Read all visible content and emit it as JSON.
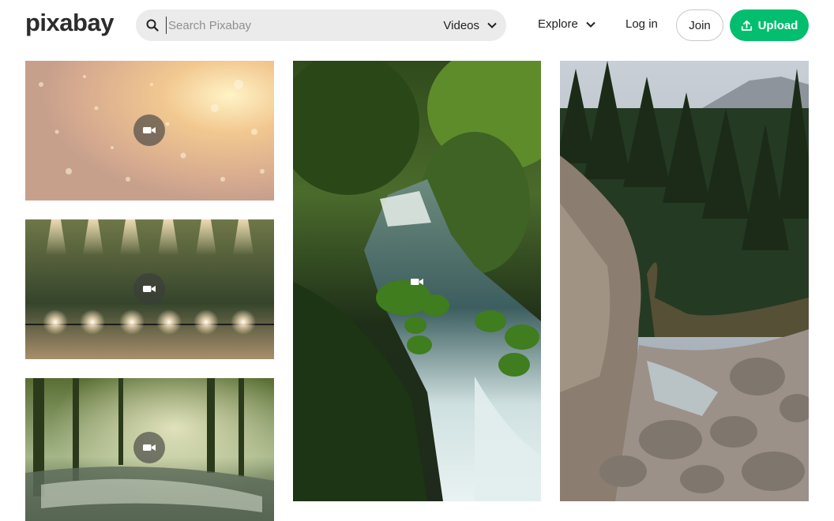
{
  "header": {
    "logo_text": "pixabay",
    "search": {
      "placeholder": "Search Pixabay",
      "value": "",
      "media_type": "Videos"
    },
    "nav": {
      "explore": "Explore",
      "login": "Log in",
      "join": "Join",
      "upload": "Upload"
    }
  },
  "colors": {
    "brand_green": "#02be6e",
    "search_bg": "#ebebeb",
    "text": "#222222"
  },
  "gallery": {
    "items": [
      {
        "subject": "golden bokeh sparkles",
        "media": "video",
        "icon": "video-camera-icon"
      },
      {
        "subject": "row of spotlights on dark green wall",
        "media": "video",
        "icon": "video-camera-icon"
      },
      {
        "subject": "misty sunlit forest stream",
        "media": "video",
        "icon": "video-camera-icon"
      },
      {
        "subject": "forest waterfall with mossy rocks",
        "media": "video",
        "icon": "video-camera-icon"
      },
      {
        "subject": "mountain river among rocks and pines",
        "media": "video",
        "icon": ""
      }
    ]
  }
}
